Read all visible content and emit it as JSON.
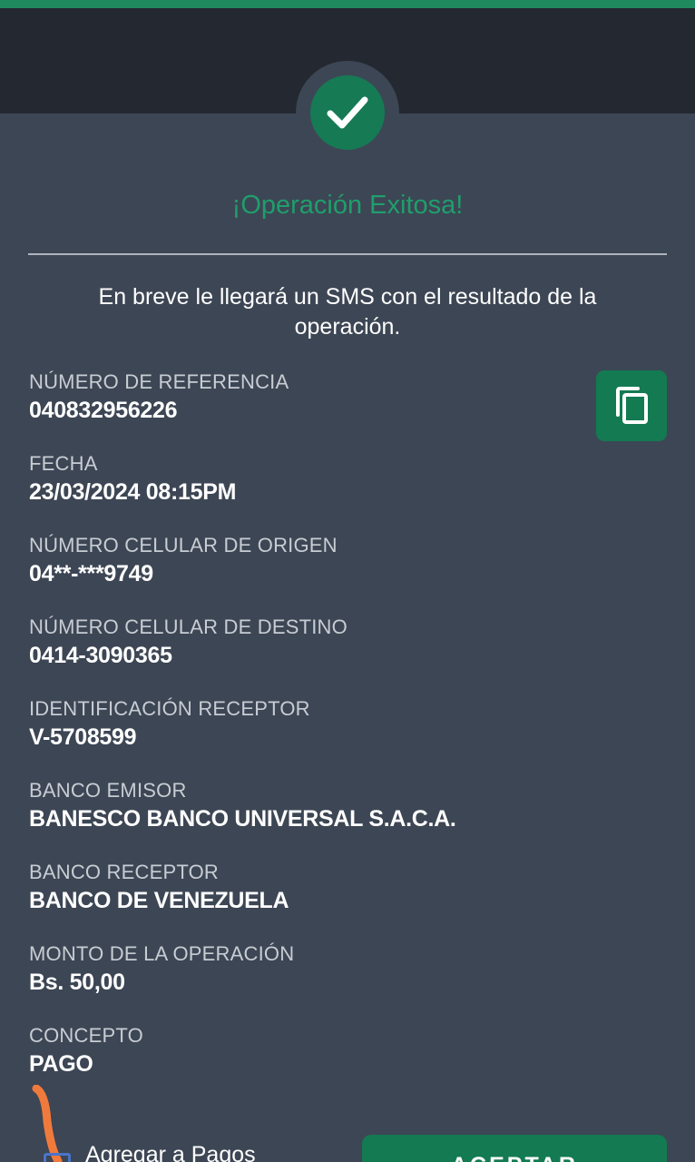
{
  "status": {
    "title": "¡Operación Exitosa!",
    "message": "En breve le llegará un SMS con el resultado de la operación."
  },
  "fields": [
    {
      "label": "NÚMERO DE REFERENCIA",
      "value": "040832956226"
    },
    {
      "label": "FECHA",
      "value": "23/03/2024 08:15PM"
    },
    {
      "label": "NÚMERO CELULAR DE ORIGEN",
      "value": "04**-***9749"
    },
    {
      "label": "NÚMERO CELULAR DE DESTINO",
      "value": "0414-3090365"
    },
    {
      "label": "IDENTIFICACIÓN RECEPTOR",
      "value": "V-5708599"
    },
    {
      "label": "BANCO EMISOR",
      "value": "BANESCO BANCO UNIVERSAL S.A.C.A."
    },
    {
      "label": "BANCO RECEPTOR",
      "value": "BANCO DE VENEZUELA"
    },
    {
      "label": "MONTO DE LA OPERACIÓN",
      "value": "Bs. 50,00"
    },
    {
      "label": "CONCEPTO",
      "value": "PAGO"
    }
  ],
  "actions": {
    "add_to_payments_label": "Agregar a Pagos",
    "accept_label": "ACEPTAR"
  },
  "icons": {
    "success": "check-circle-icon",
    "copy": "copy-icon"
  },
  "colors": {
    "accent": "#167a55",
    "success_text": "#1f9e6c",
    "background": "#3d4654",
    "header": "#232831"
  }
}
